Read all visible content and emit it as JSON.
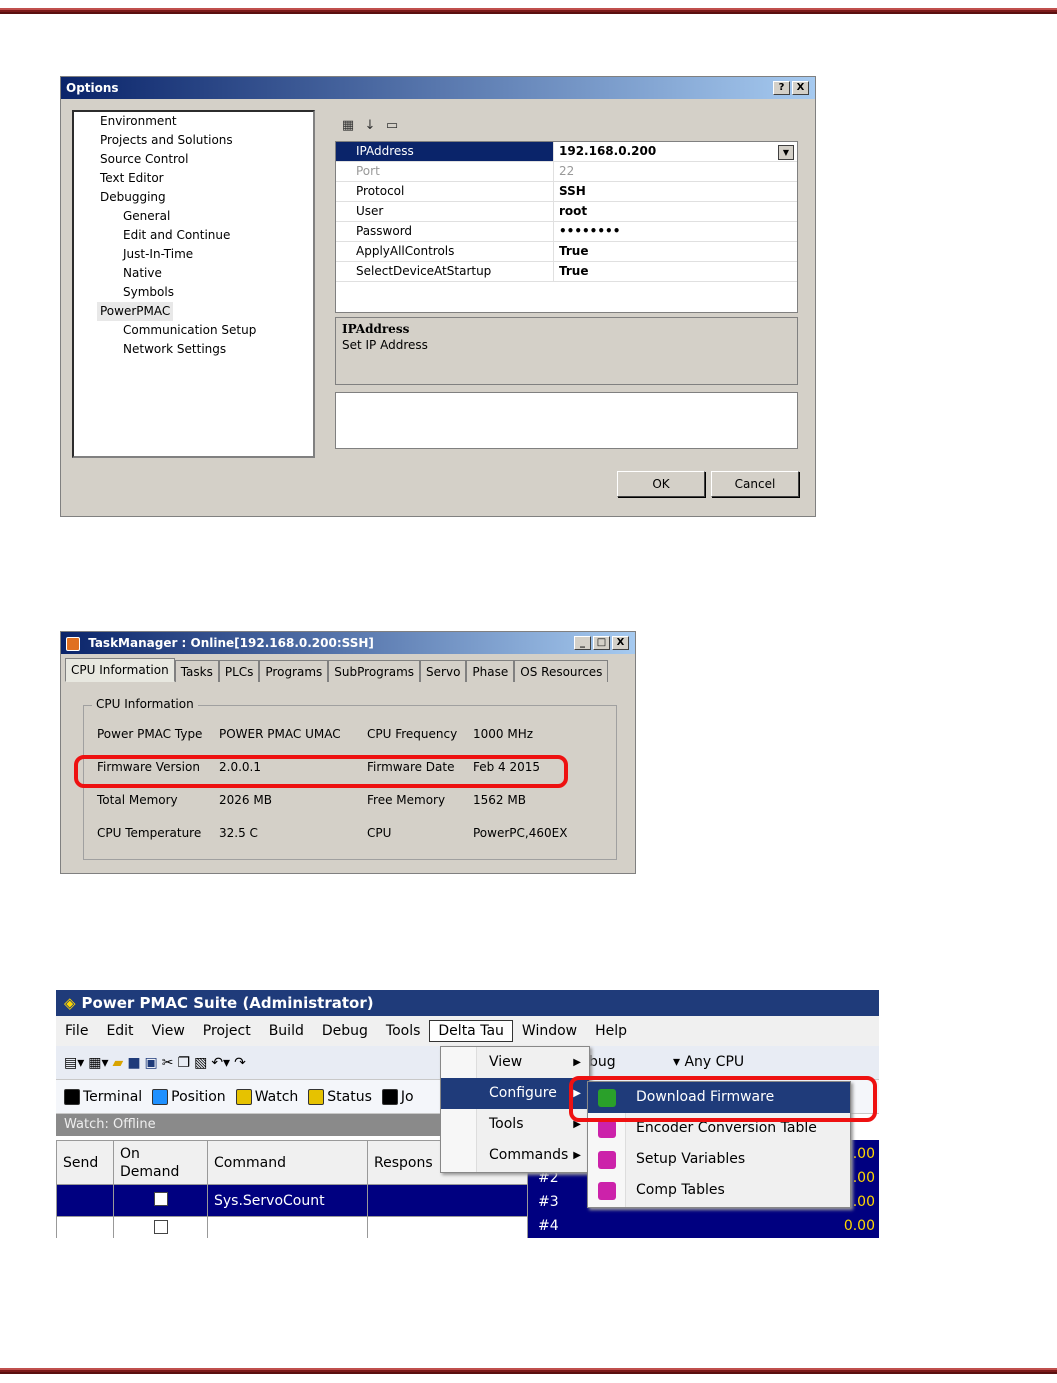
{
  "options": {
    "title": "Options",
    "title_buttons": [
      "?",
      "X"
    ],
    "tree": [
      {
        "label": "Environment",
        "level": 1
      },
      {
        "label": "Projects and Solutions",
        "level": 1
      },
      {
        "label": "Source Control",
        "level": 1
      },
      {
        "label": "Text Editor",
        "level": 1
      },
      {
        "label": "Debugging",
        "level": 1
      },
      {
        "label": "General",
        "level": 2
      },
      {
        "label": "Edit and Continue",
        "level": 2
      },
      {
        "label": "Just-In-Time",
        "level": 2
      },
      {
        "label": "Native",
        "level": 2
      },
      {
        "label": "Symbols",
        "level": 2
      },
      {
        "label": "PowerPMAC",
        "level": 1,
        "selected": true
      },
      {
        "label": "Communication Setup",
        "level": 2
      },
      {
        "label": "Network Settings",
        "level": 2
      }
    ],
    "properties": [
      {
        "name": "IPAddress",
        "value": "192.168.0.200",
        "selected": true
      },
      {
        "name": "Port",
        "value": "22",
        "disabled": true
      },
      {
        "name": "Protocol",
        "value": "SSH"
      },
      {
        "name": "User",
        "value": "root"
      },
      {
        "name": "Password",
        "value": "••••••••"
      },
      {
        "name": "ApplyAllControls",
        "value": "True"
      },
      {
        "name": "SelectDeviceAtStartup",
        "value": "True"
      }
    ],
    "description_title": "IPAddress",
    "description_text": "Set IP Address",
    "ok_label": "OK",
    "cancel_label": "Cancel"
  },
  "taskmanager": {
    "title": "TaskManager : Online[192.168.0.200:SSH]",
    "tabs": [
      "CPU Information",
      "Tasks",
      "PLCs",
      "Programs",
      "SubPrograms",
      "Servo",
      "Phase",
      "OS Resources"
    ],
    "group_title": "CPU  Information",
    "rows": [
      {
        "l1": "Power PMAC Type",
        "v1": "POWER PMAC UMAC",
        "l2": "CPU Frequency",
        "v2": "1000 MHz"
      },
      {
        "l1": "Firmware Version",
        "v1": "2.0.0.1",
        "l2": "Firmware Date",
        "v2": "Feb  4 2015"
      },
      {
        "l1": "Total Memory",
        "v1": "2026 MB",
        "l2": "Free Memory",
        "v2": "1562 MB"
      },
      {
        "l1": "CPU Temperature",
        "v1": "32.5 C",
        "l2": "CPU",
        "v2": "PowerPC,460EX"
      }
    ]
  },
  "suite": {
    "title": "Power PMAC Suite (Administrator)",
    "menus": [
      "File",
      "Edit",
      "View",
      "Project",
      "Build",
      "Debug",
      "Tools",
      "Delta Tau",
      "Window",
      "Help"
    ],
    "toolbar2": [
      {
        "label": "Terminal",
        "color": "#000000"
      },
      {
        "label": "Position",
        "color": "#1e90ff"
      },
      {
        "label": "Watch",
        "color": "#e6c200"
      },
      {
        "label": "Status",
        "color": "#e6c200"
      },
      {
        "label": "Jo",
        "color": "#000000"
      }
    ],
    "config_partial": "bug",
    "platform": "Any CPU",
    "watch_header": "Watch: Offline",
    "watch_cols": [
      "Send",
      "On Demand",
      "Command",
      "Respons"
    ],
    "watch_row1": "Sys.ServoCount",
    "delta_menu": [
      {
        "label": "View",
        "sub": true
      },
      {
        "label": "Configure",
        "sub": true,
        "highlight": true
      },
      {
        "label": "Tools",
        "sub": true
      },
      {
        "label": "Commands",
        "sub": true
      }
    ],
    "configure_menu": [
      {
        "label": "Download Firmware",
        "highlight": true,
        "icon_color": "#2aa02a"
      },
      {
        "label": "Encoder Conversion Table",
        "icon_color": "#cc22aa"
      },
      {
        "label": "Setup Variables",
        "icon_color": "#cc22aa"
      },
      {
        "label": "Comp Tables",
        "icon_color": "#cc22aa"
      }
    ],
    "motor_rows": [
      {
        "label": "",
        "value": ".00"
      },
      {
        "label": "#2",
        "value": ".00"
      },
      {
        "label": "#3",
        "value": ".00"
      },
      {
        "label": "#4",
        "value": "0.00"
      }
    ]
  }
}
